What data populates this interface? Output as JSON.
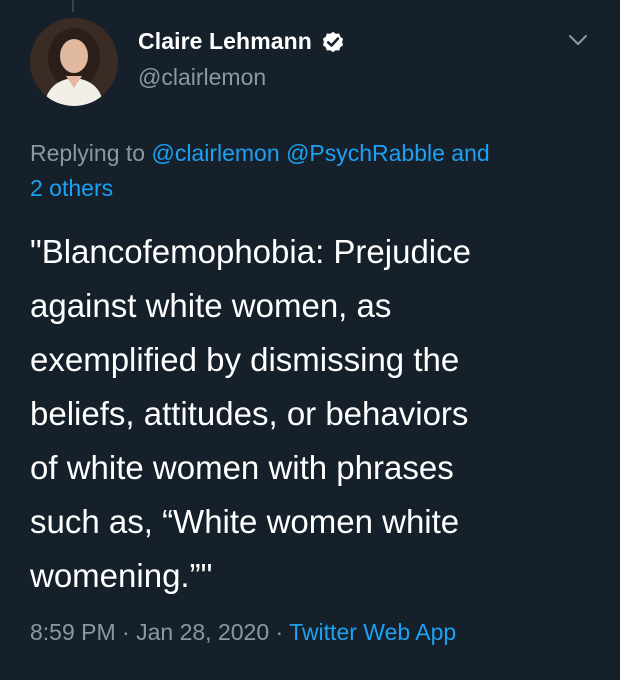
{
  "author": {
    "display_name": "Claire Lehmann",
    "handle": "@clairlemon",
    "verified_icon": "verified-badge-icon"
  },
  "menu": {
    "icon": "chevron-down-icon"
  },
  "reply_context": {
    "prefix": "Replying to",
    "mention_1": "@clairlemon",
    "mention_2": "@PsychRabble",
    "conjunction": "and",
    "others": "2 others"
  },
  "tweet": {
    "lines": [
      "\"Blancofemophobia: Prejudice",
      "against white women, as",
      "exemplified by dismissing the",
      "beliefs, attitudes, or behaviors",
      "of white women with phrases",
      "such as, “White women white",
      "womening.”\""
    ]
  },
  "meta": {
    "time": "8:59 PM",
    "separator": "·",
    "date": "Jan 28, 2020",
    "source": "Twitter Web App"
  },
  "colors": {
    "background": "#15202b",
    "link": "#1da1f2",
    "secondary_text": "#8899a6"
  }
}
